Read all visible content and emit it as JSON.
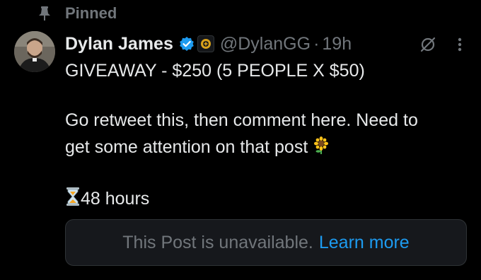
{
  "pinned": {
    "label": "Pinned",
    "icon": "pin-icon"
  },
  "post": {
    "author": {
      "display_name": "Dylan James",
      "handle": "@DylanGG",
      "verified_icon": "verified-badge-icon",
      "affiliate_icon": "affiliate-badge-icon"
    },
    "separator": "·",
    "timestamp": "19h",
    "lines": [
      "GIVEAWAY - $250 (5 PEOPLE X $50)",
      "Go retweet this, then comment here. Need to",
      "get some attention on that post",
      "48 hours"
    ],
    "emojis": {
      "sunflower": "sunflower-icon",
      "hourglass": "hourglass-icon"
    },
    "quote": {
      "unavailable_text": "This Post is unavailable.",
      "learn_more": "Learn more"
    }
  },
  "colors": {
    "background": "#000000",
    "text": "#e7e9ea",
    "muted": "#71767b",
    "link": "#1d9bf0",
    "verified": "#1d9bf0",
    "card": "#16181c",
    "card_border": "#2f3336"
  }
}
